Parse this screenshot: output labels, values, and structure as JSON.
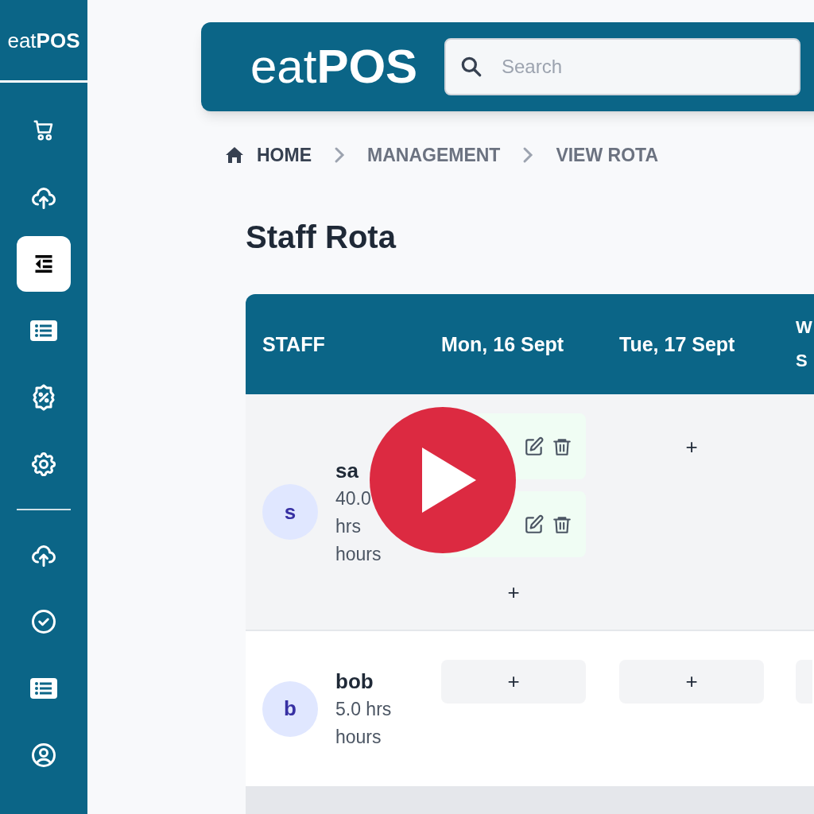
{
  "sidebar": {
    "logo": {
      "light": "eat",
      "bold": "POS"
    },
    "groups": [
      [
        {
          "selected": false
        },
        {
          "selected": false
        },
        {
          "selected": true
        },
        {
          "selected": false
        },
        {
          "selected": false
        },
        {
          "selected": false
        }
      ],
      [
        {
          "selected": false
        },
        {
          "selected": false
        },
        {
          "selected": false
        },
        {
          "selected": false
        }
      ]
    ]
  },
  "header": {
    "logo": {
      "light": "eat",
      "bold": "POS"
    },
    "search": {
      "placeholder": "Search"
    }
  },
  "breadcrumb": [
    {
      "label": "HOME",
      "kind": "home"
    },
    {
      "label": "MANAGEMENT",
      "kind": "link"
    },
    {
      "label": "VIEW ROTA",
      "kind": "link"
    }
  ],
  "title": "Staff Rota",
  "table": {
    "columns": [
      "STAFF",
      "Mon, 16 Sept",
      "Tue, 17 Sept",
      "W S"
    ],
    "rows": [
      {
        "shaded": true,
        "cells": [
          {
            "kind": "staff",
            "avatar": "s",
            "name": "sa",
            "detail_lines": [
              "40.0",
              "hrs",
              "hours"
            ]
          },
          {
            "kind": "shifts",
            "shifts": [
              {
                "kind": "shift"
              },
              {
                "kind": "shift"
              }
            ],
            "add_label": "+"
          },
          {
            "kind": "plain_add",
            "add_label": "+"
          }
        ]
      },
      {
        "shaded": false,
        "cells": [
          {
            "kind": "staff",
            "avatar": "b",
            "name": "bob",
            "detail_lines": [
              "5.0 hrs",
              "hours"
            ]
          },
          {
            "kind": "add_button",
            "add_label": "+"
          },
          {
            "kind": "add_button",
            "add_label": "+"
          },
          {
            "kind": "add_button"
          }
        ]
      }
    ]
  },
  "video_overlay": {
    "play_button": true
  }
}
